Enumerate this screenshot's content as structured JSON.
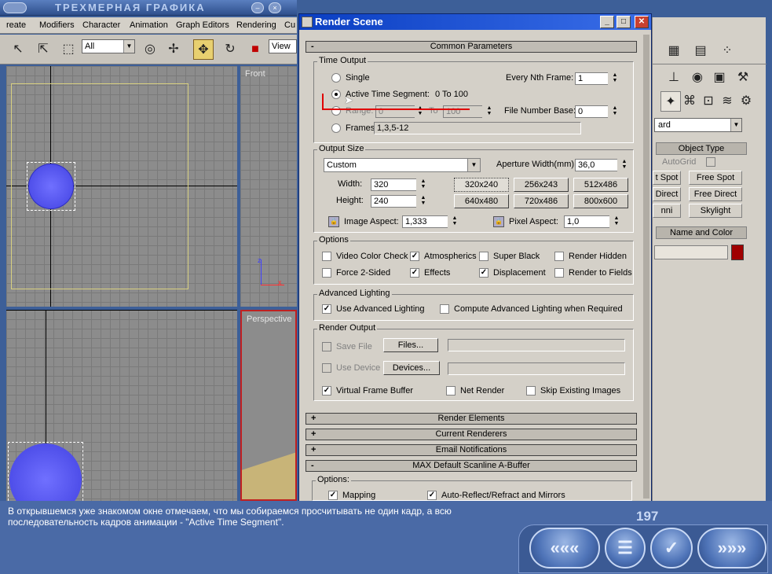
{
  "app": {
    "title": "ТРЕХМЕРНАЯ ГРАФИКА",
    "menu": [
      "reate",
      "Modifiers",
      "Character",
      "Animation",
      "Graph Editors",
      "Rendering",
      "Cu"
    ],
    "selection_filter": "All",
    "ref_coord": "View"
  },
  "viewports": {
    "front_label": "Front",
    "perspective_label": "Perspective"
  },
  "command_panel": {
    "dropdown": "ard",
    "object_type_header": "Object Type",
    "autogrid": "AutoGrid",
    "buttons": [
      "t Spot",
      "Free Spot",
      "Direct",
      "Free Direct",
      "nni",
      "Skylight"
    ],
    "name_color_header": "Name and Color",
    "color": "#a00000"
  },
  "dialog": {
    "title": "Render Scene",
    "common_params": "Common Parameters",
    "time_output": {
      "title": "Time Output",
      "single": "Single",
      "every_nth": "Every Nth Frame:",
      "every_nth_value": "1",
      "active_segment": "Active Time Segment:",
      "active_range": "0 To 100",
      "range": "Range:",
      "range_from": "0",
      "to": "To",
      "range_to": "100",
      "file_base": "File Number Base:",
      "file_base_value": "0",
      "frames": "Frames",
      "frames_value": "1,3,5-12"
    },
    "output_size": {
      "title": "Output Size",
      "preset": "Custom",
      "aperture": "Aperture Width(mm):",
      "aperture_value": "36,0",
      "width": "Width:",
      "width_value": "320",
      "height": "Height:",
      "height_value": "240",
      "presets": [
        "320x240",
        "256x243",
        "512x486",
        "640x480",
        "720x486",
        "800x600"
      ],
      "image_aspect": "Image Aspect:",
      "image_aspect_value": "1,333",
      "pixel_aspect": "Pixel Aspect:",
      "pixel_aspect_value": "1,0"
    },
    "options": {
      "title": "Options",
      "video_color": "Video Color Check",
      "atmospherics": "Atmospherics",
      "super_black": "Super Black",
      "render_hidden": "Render Hidden",
      "force2": "Force 2-Sided",
      "effects": "Effects",
      "displacement": "Displacement",
      "render_fields": "Render to Fields"
    },
    "adv_lighting": {
      "title": "Advanced Lighting",
      "use": "Use Advanced Lighting",
      "compute": "Compute Advanced Lighting when Required"
    },
    "render_output": {
      "title": "Render Output",
      "save_file": "Save File",
      "files_btn": "Files...",
      "use_device": "Use Device",
      "devices_btn": "Devices...",
      "vfb": "Virtual Frame Buffer",
      "net_render": "Net Render",
      "skip": "Skip Existing Images"
    },
    "rollouts": [
      "Render Elements",
      "Current Renderers",
      "Email Notifications"
    ],
    "scanline": "MAX Default Scanline A-Buffer",
    "scan_options": "Options:",
    "mapping": "Mapping",
    "auto_reflect": "Auto-Reflect/Refract and Mirrors"
  },
  "lesson": {
    "caption": "В открывшемся уже знакомом окне отмечаем, что мы собираемся просчитывать не один кадр, а всю последовательность кадров анимации - \"Active Time Segment\".",
    "page": "197",
    "nav": [
      "back-icon",
      "menu-icon",
      "check-icon",
      "forward-icon"
    ]
  }
}
